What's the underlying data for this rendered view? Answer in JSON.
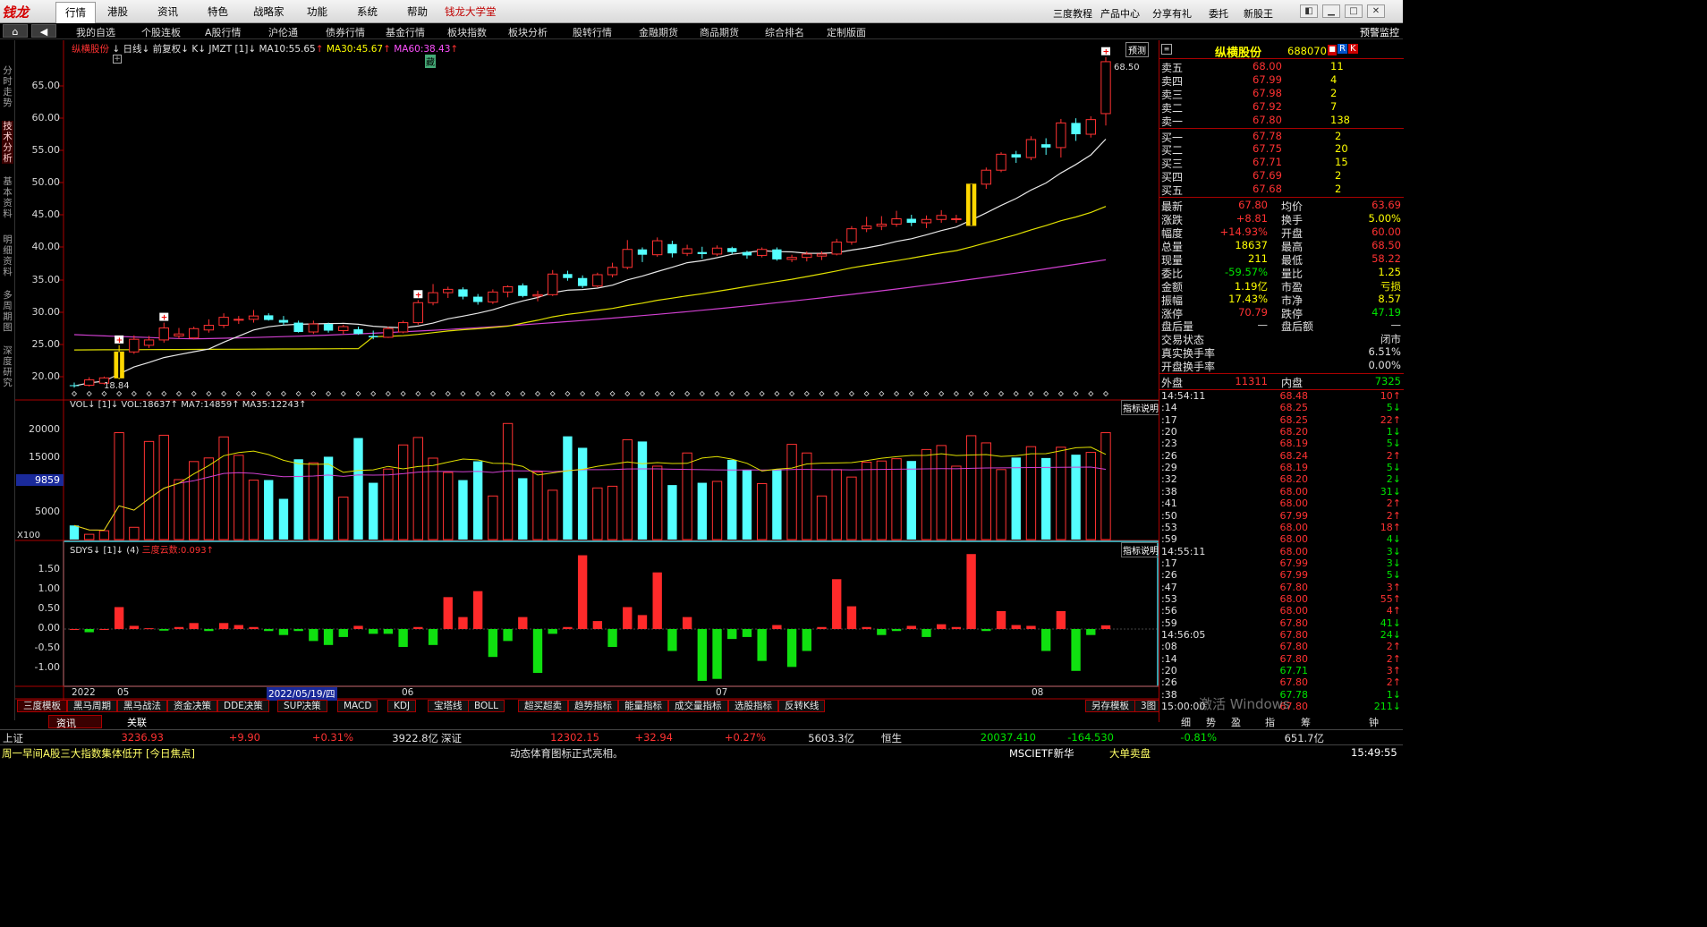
{
  "menubar": {
    "logo": "钱龙",
    "items": [
      "行情",
      "港股",
      "资讯",
      "特色",
      "战略家",
      "功能",
      "系统",
      "帮助",
      "钱龙大学堂"
    ],
    "right": [
      "三度教程",
      "产品中心",
      "分享有礼",
      "委托",
      "新股王"
    ]
  },
  "toolbar": {
    "items": [
      "我的自选",
      "个股连板",
      "A股行情",
      "沪伦通",
      "债券行情",
      "基金行情",
      "板块指数",
      "板块分析",
      "股转行情",
      "金融期货",
      "商品期货",
      "综合排名",
      "定制版面"
    ],
    "right": "预警监控"
  },
  "leftnav": [
    "分时走势",
    "技术分析",
    "基本资料",
    "明细资料",
    "多周期图",
    "深度研究"
  ],
  "chart": {
    "header_name": "纵横股份",
    "header_period": "日线",
    "header_adj": "前复权",
    "header_k": "K",
    "header_jmzt": "JMZT",
    "header_n": "[1]",
    "ma10": "MA10:55.65",
    "ma30": "MA30:45.67",
    "ma60": "MA60:38.43",
    "badge": "预测",
    "marker": "藏",
    "high_label": "68.50",
    "low_label": "18.84",
    "y_ticks": [
      "65.00",
      "60.00",
      "55.00",
      "50.00",
      "45.00",
      "40.00",
      "35.00",
      "30.00",
      "25.00",
      "20.00"
    ],
    "vol_header": "VOL↓ [1]↓ VOL:18637↑ MA7:14859↑ MA35:12243↑",
    "vol_ticks": [
      "20000",
      "15000",
      "9859",
      "5000"
    ],
    "vol_unit": "X100",
    "explain": "指标说明",
    "sd_header": "SDYS↓ [1]↓ (4)",
    "sd_value": "三度云数:0.093↑",
    "sd_ticks": [
      "1.50",
      "1.00",
      "0.50",
      "0.00",
      "-0.50",
      "-1.00"
    ],
    "x_labels": [
      "2022",
      "05",
      "06",
      "07",
      "08"
    ],
    "cursor_date": "2022/05/19/四"
  },
  "chart_data": {
    "type": "candlestick",
    "symbol": "纵横股份",
    "period": "日线",
    "ma": {
      "MA10": 55.65,
      "MA30": 45.67,
      "MA60": 38.43
    },
    "ohlc": [
      [
        19.2,
        19.6,
        18.84,
        19.1
      ],
      [
        19.2,
        20.4,
        19.0,
        20.0
      ],
      [
        19.5,
        20.5,
        19.3,
        20.3
      ],
      [
        20.3,
        25.2,
        20.1,
        24.2
      ],
      [
        24.2,
        26.7,
        23.9,
        26.1
      ],
      [
        25.2,
        26.6,
        24.8,
        26.0
      ],
      [
        26.0,
        28.6,
        25.6,
        27.8
      ],
      [
        26.6,
        27.8,
        26.2,
        26.9
      ],
      [
        26.3,
        28.0,
        26.1,
        27.7
      ],
      [
        27.5,
        29.1,
        27.1,
        28.2
      ],
      [
        28.2,
        30.0,
        27.8,
        29.4
      ],
      [
        29.0,
        29.6,
        28.4,
        29.1
      ],
      [
        29.1,
        30.5,
        28.6,
        29.6
      ],
      [
        29.7,
        30.0,
        28.9,
        29.0
      ],
      [
        29.0,
        29.6,
        28.2,
        28.6
      ],
      [
        28.6,
        28.9,
        27.1,
        27.2
      ],
      [
        27.2,
        28.9,
        26.9,
        28.4
      ],
      [
        28.4,
        28.6,
        27.1,
        27.4
      ],
      [
        27.4,
        28.3,
        26.8,
        28.0
      ],
      [
        27.6,
        28.0,
        26.8,
        26.9
      ],
      [
        26.6,
        27.4,
        26.1,
        26.4
      ],
      [
        26.4,
        28.0,
        26.3,
        27.7
      ],
      [
        27.2,
        28.9,
        27.0,
        28.6
      ],
      [
        28.6,
        32.0,
        28.3,
        31.6
      ],
      [
        31.6,
        34.4,
        31.2,
        33.1
      ],
      [
        33.1,
        34.0,
        32.3,
        33.6
      ],
      [
        33.6,
        33.9,
        32.1,
        32.5
      ],
      [
        32.5,
        32.9,
        31.3,
        31.7
      ],
      [
        31.7,
        33.6,
        31.4,
        33.2
      ],
      [
        33.2,
        34.2,
        32.4,
        34.0
      ],
      [
        34.2,
        34.5,
        32.4,
        32.6
      ],
      [
        32.6,
        33.4,
        31.8,
        32.8
      ],
      [
        32.8,
        36.5,
        32.6,
        35.9
      ],
      [
        35.9,
        36.4,
        34.9,
        35.3
      ],
      [
        35.3,
        35.7,
        33.8,
        34.1
      ],
      [
        34.1,
        36.1,
        33.9,
        35.8
      ],
      [
        35.8,
        37.6,
        35.4,
        36.9
      ],
      [
        36.9,
        41.0,
        36.6,
        39.6
      ],
      [
        39.6,
        39.9,
        37.7,
        38.8
      ],
      [
        38.8,
        41.4,
        38.5,
        40.9
      ],
      [
        40.4,
        40.9,
        38.4,
        39.0
      ],
      [
        39.0,
        40.3,
        38.6,
        39.7
      ],
      [
        39.2,
        40.0,
        38.2,
        38.9
      ],
      [
        38.9,
        40.2,
        38.6,
        39.8
      ],
      [
        39.8,
        40.0,
        38.9,
        39.2
      ],
      [
        39.2,
        39.4,
        38.2,
        38.7
      ],
      [
        38.7,
        39.9,
        38.4,
        39.6
      ],
      [
        39.6,
        39.9,
        37.9,
        38.1
      ],
      [
        38.1,
        38.8,
        37.7,
        38.4
      ],
      [
        38.4,
        39.3,
        37.8,
        38.9
      ],
      [
        38.6,
        39.3,
        38.0,
        38.9
      ],
      [
        38.9,
        41.2,
        38.7,
        40.7
      ],
      [
        40.7,
        43.1,
        40.3,
        42.7
      ],
      [
        42.7,
        44.5,
        42.2,
        43.1
      ],
      [
        43.1,
        44.6,
        42.5,
        43.4
      ],
      [
        43.4,
        45.4,
        43.0,
        44.2
      ],
      [
        44.2,
        44.8,
        43.1,
        43.6
      ],
      [
        43.6,
        44.7,
        42.8,
        44.1
      ],
      [
        44.1,
        45.5,
        43.6,
        44.7
      ],
      [
        44.2,
        44.8,
        43.6,
        44.2
      ],
      [
        43.2,
        49.4,
        43.2,
        49.4
      ],
      [
        49.4,
        51.9,
        48.7,
        51.5
      ],
      [
        51.5,
        54.2,
        51.2,
        53.9
      ],
      [
        53.9,
        54.4,
        52.6,
        53.4
      ],
      [
        53.4,
        56.6,
        53.0,
        56.1
      ],
      [
        55.4,
        56.3,
        53.8,
        54.9
      ],
      [
        54.9,
        59.2,
        53.4,
        58.6
      ],
      [
        58.6,
        59.3,
        55.9,
        56.9
      ],
      [
        56.9,
        59.6,
        56.4,
        59.1
      ],
      [
        60.0,
        68.5,
        58.22,
        67.8
      ]
    ],
    "volume": [
      2460,
      920,
      1540,
      18640,
      2140,
      17110,
      18190,
      10450,
      13600,
      14230,
      17900,
      14690,
      10360,
      10380,
      7100,
      14000,
      13380,
      14440,
      7400,
      17700,
      9900,
      12300,
      16500,
      17800,
      14200,
      11700,
      10370,
      13650,
      7600,
      20240,
      10700,
      11800,
      8600,
      18000,
      16000,
      9000,
      9300,
      17400,
      17100,
      12800,
      9500,
      15100,
      9900,
      10140,
      13900,
      12100,
      9750,
      12250,
      16600,
      15100,
      7600,
      12200,
      10900,
      13500,
      13700,
      14100,
      13700,
      15700,
      16400,
      12800,
      18110,
      16860,
      12200,
      14300,
      16200,
      14220,
      16100,
      14800,
      15200,
      18637
    ],
    "vol_ma7": [
      2460,
      1690,
      1640,
      5890,
      5140,
      7140,
      8960,
      9830,
      11450,
      12900,
      14620,
      15170,
      15430,
      14830,
      13830,
      13230,
      13100,
      13170,
      11720,
      12060,
      12160,
      12760,
      12330,
      12730,
      12900,
      13490,
      14040,
      13890,
      13290,
      13260,
      12760,
      11250,
      11630,
      12000,
      12250,
      12780,
      13160,
      13530,
      13210,
      13420,
      13260,
      13300,
      14210,
      14480,
      14020,
      13290,
      11950,
      12290,
      12460,
      13190,
      13330,
      13350,
      13420,
      13760,
      14180,
      14450,
      14670,
      14690,
      14970,
      14650,
      14750,
      14830,
      14500,
      14620,
      14960,
      14980,
      15500,
      16010,
      16100,
      14859
    ],
    "vol_ma35": [
      2460,
      1690,
      1640,
      5890,
      5140,
      7140,
      8960,
      9830,
      10250,
      10900,
      11530,
      11660,
      11540,
      11240,
      10950,
      11000,
      11080,
      11250,
      11020,
      11270,
      11240,
      11260,
      11490,
      11760,
      11880,
      11880,
      11830,
      11890,
      11700,
      12000,
      11980,
      11970,
      11840,
      12000,
      12180,
      12180,
      12220,
      12310,
      12330,
      12320,
      12260,
      12240,
      12180,
      12150,
      12130,
      12150,
      12130,
      12140,
      12220,
      12230,
      12180,
      12180,
      12160,
      12200,
      12240,
      12270,
      12300,
      12330,
      12350,
      12340,
      12420,
      12480,
      12500,
      12520,
      12560,
      12570,
      12600,
      12620,
      12640,
      12243
    ],
    "sdys": [
      0,
      -0.08,
      0,
      0.55,
      0.08,
      0.02,
      -0.04,
      0.05,
      0.15,
      -0.05,
      0.15,
      0.1,
      0.05,
      -0.05,
      -0.15,
      -0.05,
      -0.3,
      -0.4,
      -0.2,
      0.08,
      -0.12,
      -0.12,
      -0.45,
      0.05,
      -0.4,
      0.8,
      0.3,
      0.95,
      -0.7,
      -0.3,
      0.3,
      -1.1,
      -0.12,
      0.05,
      1.85,
      0.2,
      -0.45,
      0.55,
      0.35,
      1.42,
      -0.55,
      0.3,
      -1.3,
      -1.25,
      -0.25,
      -0.2,
      -0.8,
      0.1,
      -0.95,
      -0.55,
      0.05,
      1.25,
      0.57,
      0.05,
      -0.15,
      -0.05,
      0.08,
      -0.2,
      0.12,
      0.05,
      1.88,
      -0.05,
      0.45,
      0.1,
      0.08,
      -0.55,
      0.45,
      -1.05,
      -0.15,
      0.093
    ],
    "price_range": [
      19.0,
      69.0
    ]
  },
  "quote": {
    "name": "纵横股份",
    "code": "688070",
    "badges": [
      "R",
      "K"
    ],
    "sells": [
      {
        "l": "卖五",
        "p": "68.00",
        "v": "11"
      },
      {
        "l": "卖四",
        "p": "67.99",
        "v": "4"
      },
      {
        "l": "卖三",
        "p": "67.98",
        "v": "2"
      },
      {
        "l": "卖二",
        "p": "67.92",
        "v": "7"
      },
      {
        "l": "卖一",
        "p": "67.80",
        "v": "138"
      }
    ],
    "buys": [
      {
        "l": "买一",
        "p": "67.78",
        "v": "2"
      },
      {
        "l": "买二",
        "p": "67.75",
        "v": "20"
      },
      {
        "l": "买三",
        "p": "67.71",
        "v": "15"
      },
      {
        "l": "买四",
        "p": "67.69",
        "v": "2"
      },
      {
        "l": "买五",
        "p": "67.68",
        "v": "2"
      }
    ],
    "stats": [
      {
        "a": "最新",
        "av": "67.80",
        "b": "均价",
        "bv": "63.69"
      },
      {
        "a": "涨跌",
        "av": "+8.81",
        "b": "换手",
        "bv": "5.00%"
      },
      {
        "a": "幅度",
        "av": "+14.93%",
        "b": "开盘",
        "bv": "60.00"
      },
      {
        "a": "总量",
        "av": "18637",
        "b": "最高",
        "bv": "68.50"
      },
      {
        "a": "现量",
        "av": "211",
        "b": "最低",
        "bv": "58.22"
      },
      {
        "a": "委比",
        "av": "-59.57%",
        "b": "量比",
        "bv": "1.25"
      },
      {
        "a": "金额",
        "av": "1.19亿",
        "b": "市盈",
        "bv": "亏损"
      },
      {
        "a": "振幅",
        "av": "17.43%",
        "b": "市净",
        "bv": "8.57"
      },
      {
        "a": "涨停",
        "av": "70.79",
        "b": "跌停",
        "bv": "47.19"
      }
    ],
    "after": {
      "a": "盘后量",
      "av": "—",
      "b": "盘后额",
      "bv": "—"
    },
    "extra": [
      {
        "a": "交易状态",
        "v": "闭市"
      },
      {
        "a": "真实换手率",
        "v": "6.51%"
      },
      {
        "a": "开盘换手率",
        "v": "0.00%"
      }
    ],
    "outer": {
      "l": "外盘",
      "v": "11311",
      "l2": "内盘",
      "v2": "7325"
    },
    "ticks": [
      {
        "t": "14:54:11",
        "p": "68.48",
        "v": "10↑"
      },
      {
        "t": ":14",
        "p": "68.25",
        "v": "5↓"
      },
      {
        "t": ":17",
        "p": "68.25",
        "v": "22↑"
      },
      {
        "t": ":20",
        "p": "68.20",
        "v": "1↓"
      },
      {
        "t": ":23",
        "p": "68.19",
        "v": "5↓"
      },
      {
        "t": ":26",
        "p": "68.24",
        "v": "2↑"
      },
      {
        "t": ":29",
        "p": "68.19",
        "v": "5↓"
      },
      {
        "t": ":32",
        "p": "68.20",
        "v": "2↓"
      },
      {
        "t": ":38",
        "p": "68.00",
        "v": "31↓"
      },
      {
        "t": ":41",
        "p": "68.00",
        "v": "2↑"
      },
      {
        "t": ":50",
        "p": "67.99",
        "v": "2↑"
      },
      {
        "t": ":53",
        "p": "68.00",
        "v": "18↑"
      },
      {
        "t": ":59",
        "p": "68.00",
        "v": "4↓"
      },
      {
        "t": "14:55:11",
        "p": "68.00",
        "v": "3↓"
      },
      {
        "t": ":17",
        "p": "67.99",
        "v": "3↓"
      },
      {
        "t": ":26",
        "p": "67.99",
        "v": "5↓"
      },
      {
        "t": ":47",
        "p": "67.80",
        "v": "3↑"
      },
      {
        "t": ":53",
        "p": "68.00",
        "v": "55↑"
      },
      {
        "t": ":56",
        "p": "68.00",
        "v": "4↑"
      },
      {
        "t": ":59",
        "p": "67.80",
        "v": "41↓"
      },
      {
        "t": "14:56:05",
        "p": "67.80",
        "v": "24↓"
      },
      {
        "t": ":08",
        "p": "67.80",
        "v": "2↑"
      },
      {
        "t": ":14",
        "p": "67.80",
        "v": "2↑"
      },
      {
        "t": ":20",
        "p": "67.71",
        "v": "3↑"
      },
      {
        "t": ":26",
        "p": "67.80",
        "v": "2↑"
      },
      {
        "t": ":38",
        "p": "67.78",
        "v": "1↓"
      },
      {
        "t": "15:00:00",
        "p": "67.80",
        "v": "211↓"
      }
    ],
    "tabs": [
      "细",
      "势",
      "盈",
      "指",
      "筹",
      "钟"
    ]
  },
  "bottomtabs": [
    "三度模板",
    "黑马周期",
    "黑马战法",
    "资金决策",
    "DDE决策",
    "SUP决策",
    "MACD",
    "KDJ",
    "宝塔线",
    "BOLL",
    "超买超卖",
    "趋势指标",
    "能量指标",
    "成交量指标",
    "选股指标",
    "反转K线"
  ],
  "bottom_right": [
    "另存模板",
    "3图"
  ],
  "subtabs": [
    "资讯",
    "关联"
  ],
  "status": [
    {
      "n": "上证",
      "p": "3236.93",
      "c": "+9.90",
      "r": "+0.31%",
      "a": "3922.8亿"
    },
    {
      "n": "深证",
      "p": "12302.15",
      "c": "+32.94",
      "r": "+0.27%",
      "a": "5603.3亿"
    },
    {
      "n": "恒生",
      "p": "20037.410",
      "c": "-164.530",
      "r": "-0.81%",
      "a": "651.7亿"
    }
  ],
  "news": {
    "headline": "周一早间A股三大指数集体低开 [今日焦点]",
    "ticker": "动态体育图标正式亮相。",
    "etf": "MSCIETF新华",
    "bigorder": "大单卖盘",
    "clock": "15:49:55"
  },
  "watermark": "激活 Windows"
}
